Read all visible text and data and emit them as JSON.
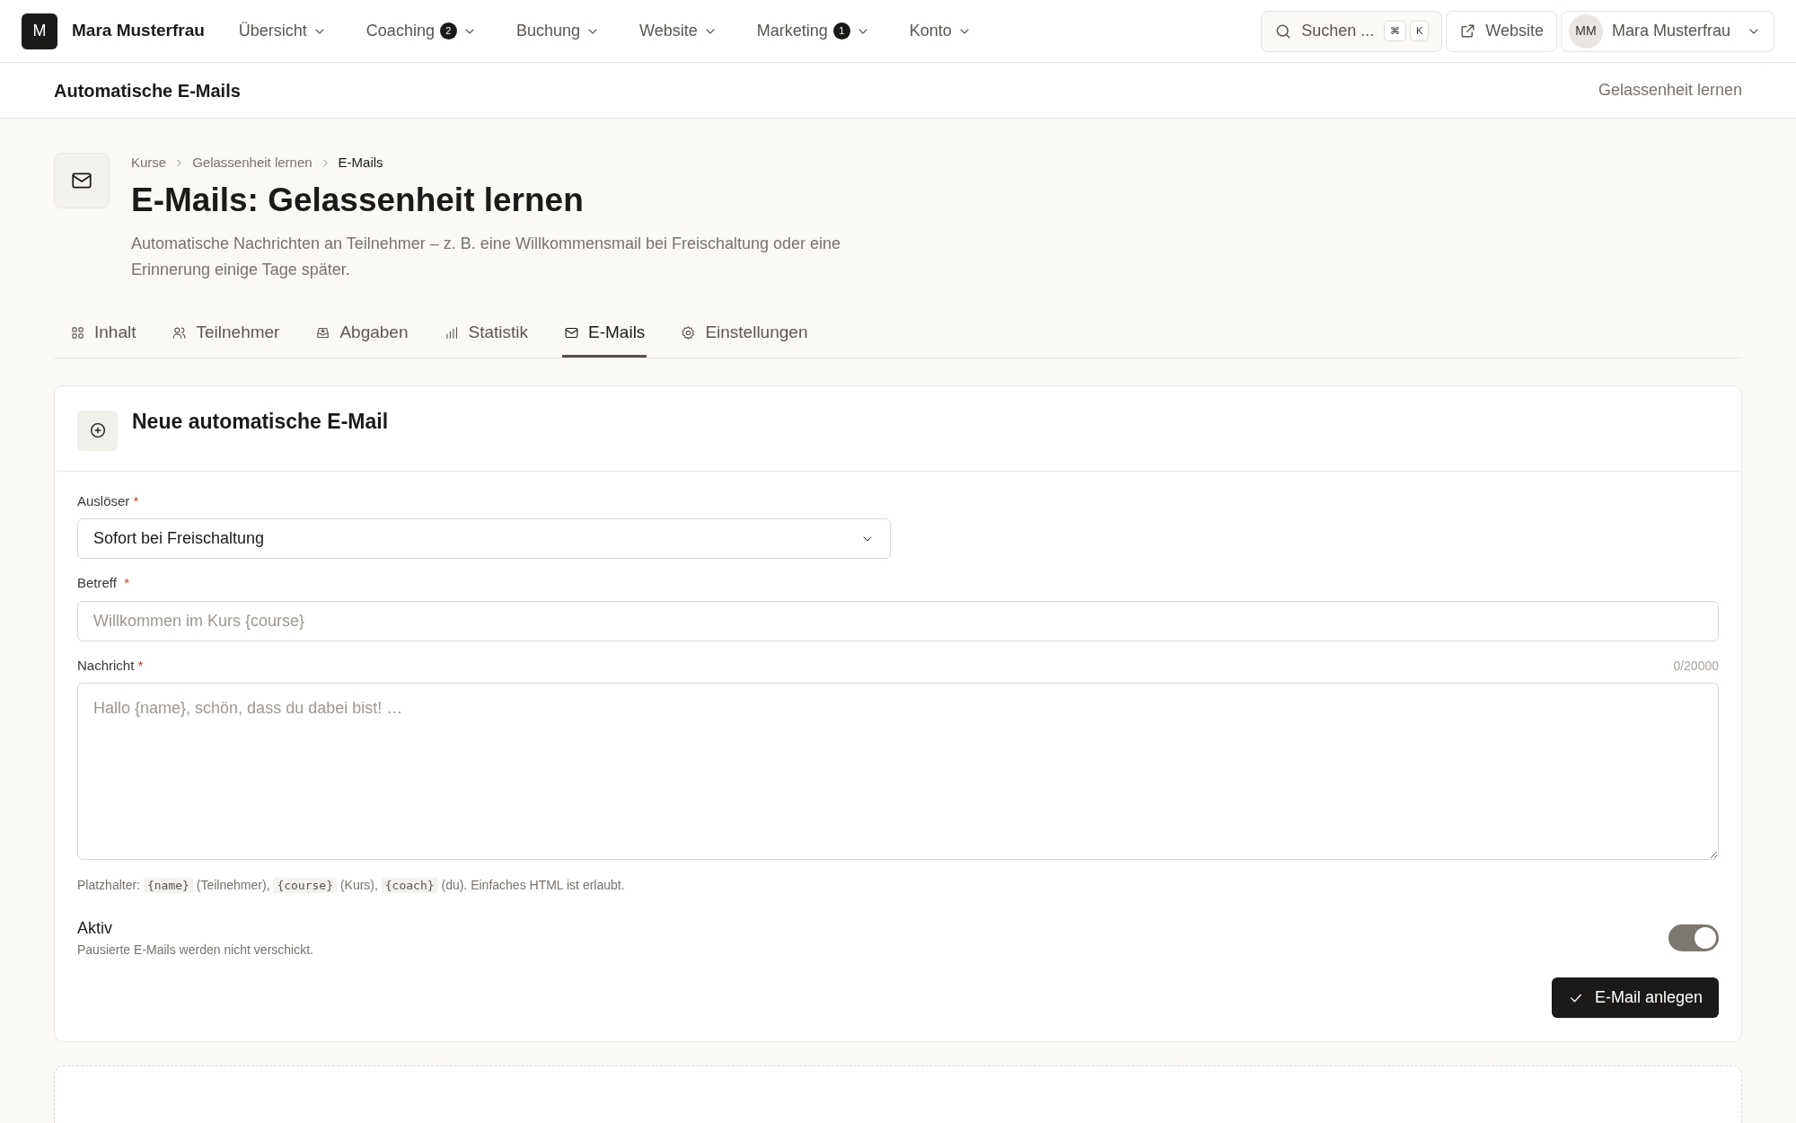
{
  "brand": {
    "initial": "M",
    "name": "Mara Musterfrau"
  },
  "nav_items": [
    {
      "label": "Übersicht"
    },
    {
      "label": "Coaching",
      "badge": "2"
    },
    {
      "label": "Buchung"
    },
    {
      "label": "Website"
    },
    {
      "label": "Marketing",
      "badge": "1"
    },
    {
      "label": "Konto"
    }
  ],
  "search": {
    "placeholder": "Suchen ...",
    "keys": [
      "⌘",
      "K"
    ]
  },
  "website_button": "Website",
  "user": {
    "initials": "MM",
    "name": "Mara Musterfrau"
  },
  "subheader": {
    "title": "Automatische E-Mails",
    "context": "Gelassenheit lernen"
  },
  "breadcrumb": [
    "Kurse",
    "Gelassenheit lernen",
    "E-Mails"
  ],
  "title": "E-Mails: Gelassenheit lernen",
  "description": "Automatische Nachrichten an Teilnehmer – z. B. eine Willkommensmail bei Freischaltung oder eine Erinnerung einige Tage später.",
  "tabs": [
    {
      "label": "Inhalt",
      "selected": false
    },
    {
      "label": "Teilnehmer",
      "selected": false
    },
    {
      "label": "Abgaben",
      "selected": false
    },
    {
      "label": "Statistik",
      "selected": false
    },
    {
      "label": "E-Mails",
      "selected": true
    },
    {
      "label": "Einstellungen",
      "selected": false
    }
  ],
  "form": {
    "title": "Neue automatische E-Mail",
    "fields": [
      {
        "kind": "select",
        "label": "Auslöser",
        "required_mark": "*",
        "value": "Sofort bei Freischaltung"
      },
      {
        "kind": "text",
        "label": "Betreff",
        "required_mark": "*",
        "placeholder": "Willkommen im Kurs {course}"
      },
      {
        "kind": "textarea",
        "label": "Nachricht",
        "required_mark": "*",
        "placeholder": "Hallo {name}, schön, dass du dabei bist! …",
        "counter": "0/20000"
      }
    ],
    "hint": [
      {
        "kind": "text",
        "text": "Platzhalter: "
      },
      {
        "kind": "code",
        "text": "{name}"
      },
      {
        "kind": "text",
        "text": " (Teilnehmer), "
      },
      {
        "kind": "code",
        "text": "{course}"
      },
      {
        "kind": "text",
        "text": " (Kurs), "
      },
      {
        "kind": "code",
        "text": "{coach}"
      },
      {
        "kind": "text",
        "text": " (du). Einfaches HTML ist erlaubt."
      }
    ],
    "active": {
      "label": "Aktiv",
      "description": "Pausierte E-Mails werden nicht verschickt.",
      "on": true
    },
    "submit": "E-Mail anlegen"
  }
}
